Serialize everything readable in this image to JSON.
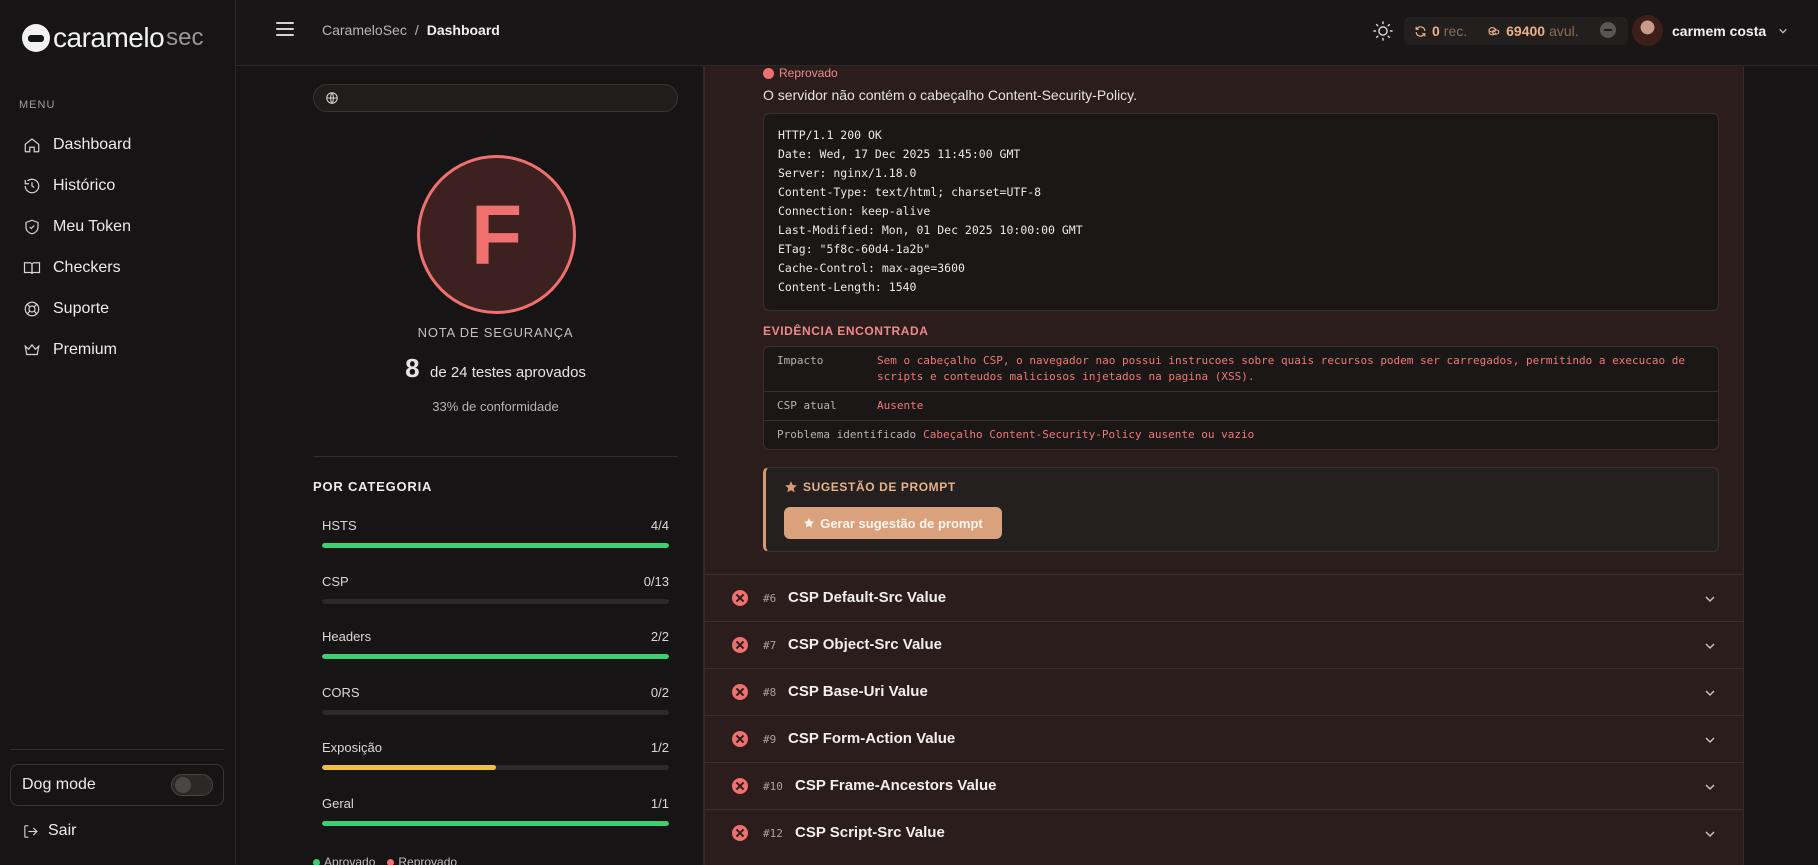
{
  "brand": {
    "main": "caramelo",
    "suffix": "sec"
  },
  "sidebar": {
    "menu_label": "MENU",
    "items": [
      {
        "label": "Dashboard",
        "icon": "home-icon"
      },
      {
        "label": "Histórico",
        "icon": "history-icon"
      },
      {
        "label": "Meu Token",
        "icon": "shield-icon"
      },
      {
        "label": "Checkers",
        "icon": "book-icon"
      },
      {
        "label": "Suporte",
        "icon": "lifebuoy-icon"
      },
      {
        "label": "Premium",
        "icon": "crown-icon"
      }
    ],
    "dog_mode_label": "Dog mode",
    "dog_mode_on": false,
    "logout_label": "Sair"
  },
  "topbar": {
    "breadcrumb_root": "CarameloSec",
    "breadcrumb_sep": "/",
    "breadcrumb_current": "Dashboard",
    "credits_rec_value": "0",
    "credits_rec_unit": "rec.",
    "credits_avul_value": "69400",
    "credits_avul_unit": "avul.",
    "user_name": "carmem costa"
  },
  "summary": {
    "domain_value": "",
    "grade": "F",
    "grade_label": "NOTA DE SEGURANÇA",
    "passed": "8",
    "passed_text": "de 24 testes aprovados",
    "conformity": "33% de conformidade",
    "category_title": "POR CATEGORIA",
    "categories": [
      {
        "name": "HSTS",
        "score": "4/4",
        "fraction": 1.0,
        "color": "#3ecf73"
      },
      {
        "name": "CSP",
        "score": "0/13",
        "fraction": 0.0,
        "color": "#3ecf73"
      },
      {
        "name": "Headers",
        "score": "2/2",
        "fraction": 1.0,
        "color": "#3ecf73"
      },
      {
        "name": "CORS",
        "score": "0/2",
        "fraction": 0.0,
        "color": "#3ecf73"
      },
      {
        "name": "Exposição",
        "score": "1/2",
        "fraction": 0.5,
        "color": "#f0c040"
      },
      {
        "name": "Geral",
        "score": "1/1",
        "fraction": 1.0,
        "color": "#3ecf73"
      }
    ],
    "legend": [
      {
        "label": "Aprovado",
        "color": "#3ecf73"
      },
      {
        "label": "Reprovado",
        "color": "#f07070"
      }
    ]
  },
  "detail": {
    "status": "Reprovado",
    "description": "O servidor não contém o cabeçalho Content-Security-Policy.",
    "response_lines": [
      "HTTP/1.1 200 OK",
      "Date: Wed, 17 Dec 2025 11:45:00 GMT",
      "Server: nginx/1.18.0",
      "Content-Type: text/html; charset=UTF-8",
      "Connection: keep-alive",
      "Last-Modified: Mon, 01 Dec 2025 10:00:00 GMT",
      "ETag: \"5f8c-60d4-1a2b\"",
      "Cache-Control: max-age=3600",
      "Content-Length: 1540"
    ],
    "evidence_title": "EVIDÊNCIA ENCONTRADA",
    "evidence": [
      {
        "key": "Impacto",
        "value": "Sem o cabeçalho CSP, o navegador nao possui instrucoes sobre quais recursos podem ser carregados, permitindo a execucao de scripts e conteudos maliciosos injetados na pagina (XSS)."
      },
      {
        "key": "CSP atual",
        "value": "Ausente"
      },
      {
        "key": "Problema identificado",
        "value": "Cabeçalho Content-Security-Policy ausente ou vazio"
      }
    ],
    "prompt_title": "SUGESTÃO DE PROMPT",
    "prompt_button": "Gerar sugestão de prompt"
  },
  "checks": [
    {
      "num": "#6",
      "title": "CSP Default-Src Value"
    },
    {
      "num": "#7",
      "title": "CSP Object-Src Value"
    },
    {
      "num": "#8",
      "title": "CSP Base-Uri Value"
    },
    {
      "num": "#9",
      "title": "CSP Form-Action Value"
    },
    {
      "num": "#10",
      "title": "CSP Frame-Ancestors Value"
    },
    {
      "num": "#12",
      "title": "CSP Script-Src Value"
    }
  ]
}
